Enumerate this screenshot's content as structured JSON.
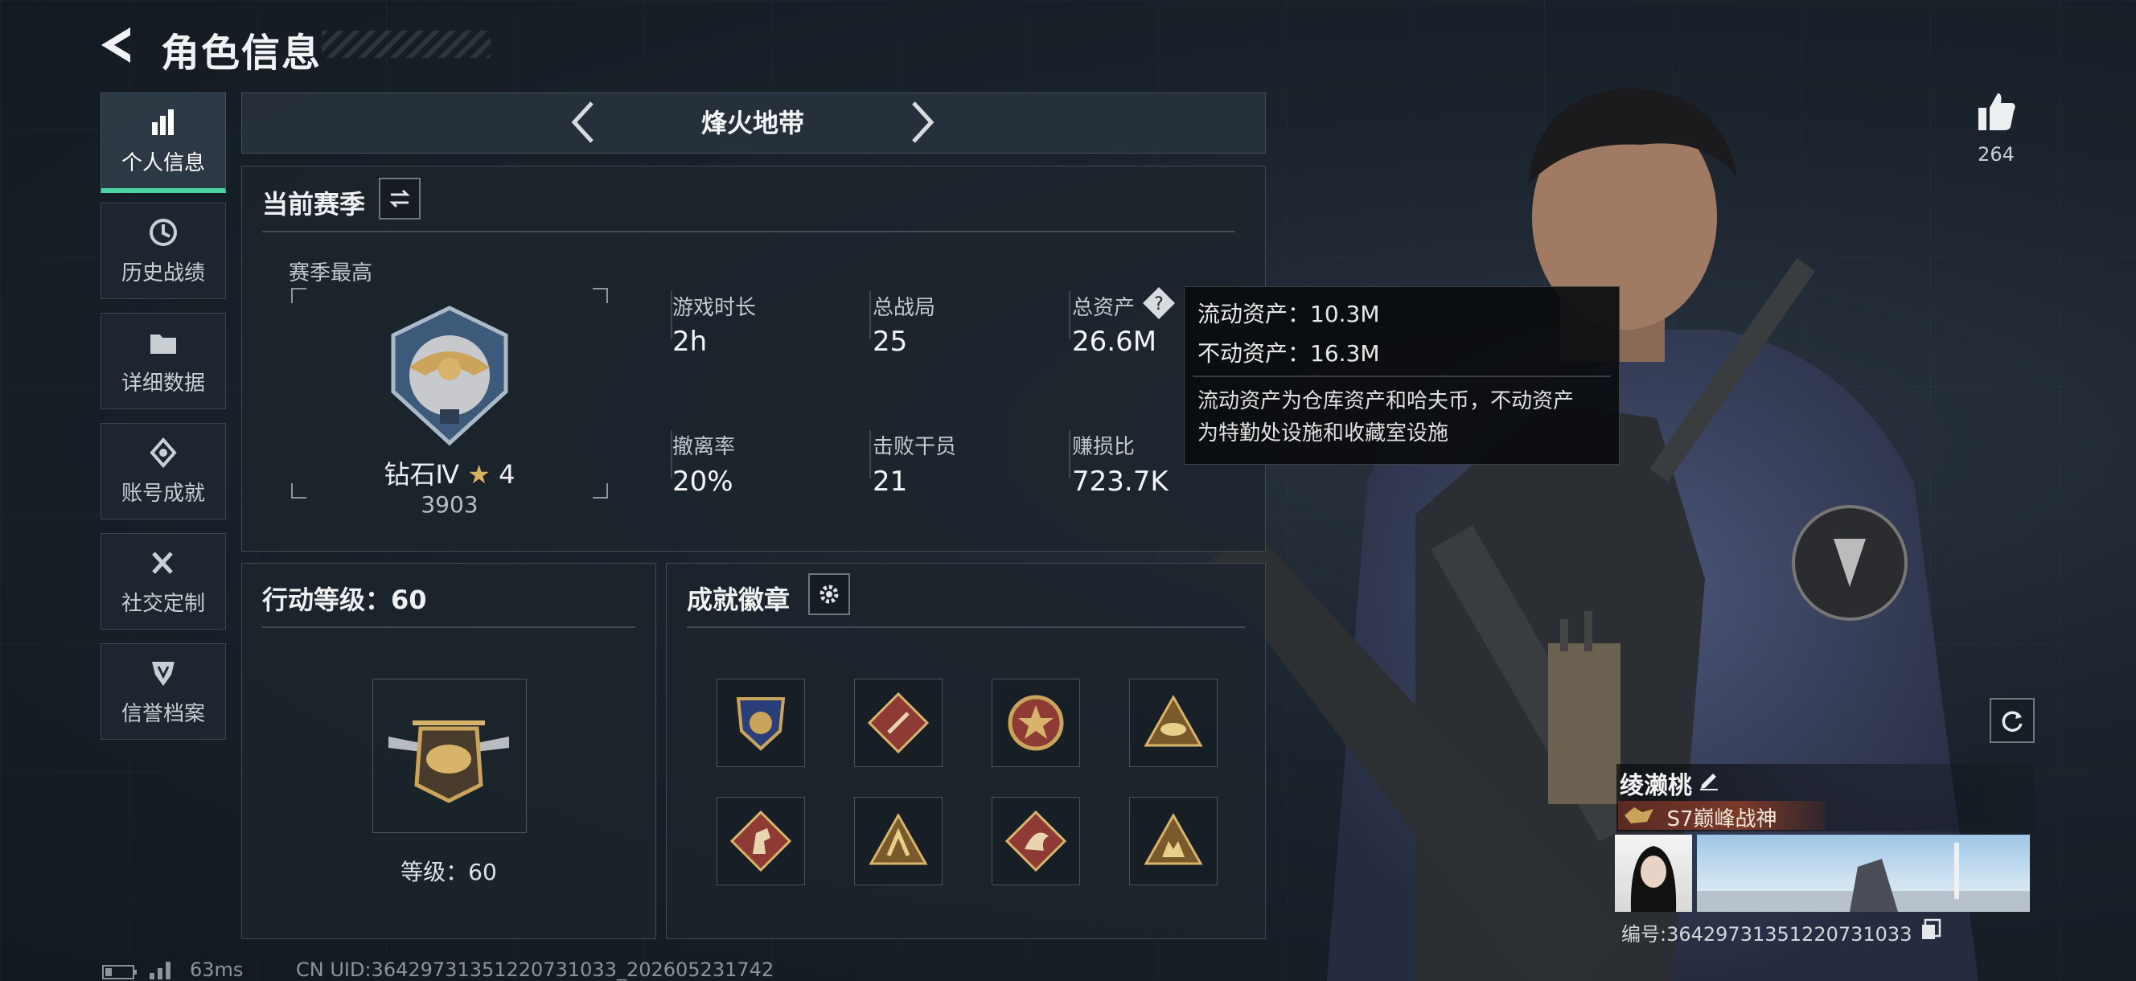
{
  "header": {
    "title": "角色信息"
  },
  "sidebar": {
    "items": [
      {
        "label": "个人信息",
        "icon": "bar-chart-icon",
        "active": true
      },
      {
        "label": "历史战绩",
        "icon": "history-clock-icon"
      },
      {
        "label": "详细数据",
        "icon": "folder-icon"
      },
      {
        "label": "账号成就",
        "icon": "achievement-icon"
      },
      {
        "label": "社交定制",
        "icon": "tools-icon"
      },
      {
        "label": "信誉档案",
        "icon": "credit-shield-icon"
      }
    ]
  },
  "mode": {
    "title": "烽火地带"
  },
  "season": {
    "title": "当前赛季",
    "best_label": "赛季最高",
    "rank_name": "钻石Ⅳ",
    "rank_stars": "4",
    "rank_score": "3903",
    "stats": [
      {
        "label": "游戏时长",
        "value": "2h"
      },
      {
        "label": "总战局",
        "value": "25"
      },
      {
        "label": "总资产",
        "value": "26.6M"
      },
      {
        "label": "撤离率",
        "value": "20%"
      },
      {
        "label": "击败干员",
        "value": "21"
      },
      {
        "label": "赚损比",
        "value": "723.7K"
      }
    ]
  },
  "tooltip": {
    "liquid": "流动资产：10.3M",
    "fixed": "不动资产：16.3M",
    "desc_line1": "流动资产为仓库资产和哈夫币，不动资产",
    "desc_line2": "为特勤处设施和收藏室设施"
  },
  "action_level": {
    "title": "行动等级：60",
    "level_text": "等级：60"
  },
  "achievements": {
    "title": "成就徽章",
    "badges": [
      "badge-1",
      "badge-2",
      "badge-3",
      "badge-4",
      "badge-5",
      "badge-6",
      "badge-7",
      "badge-8"
    ]
  },
  "likes": {
    "count": "264"
  },
  "player": {
    "name": "绫濑桃",
    "title_badge": "S7巅峰战神",
    "id_text": "编号:3642973135122073​1033"
  },
  "status": {
    "ping": "63ms",
    "uid": "CN UID:364297313512207​31033_202605231742"
  },
  "colors": {
    "accent_green": "#49d3a0",
    "tooltip_bg": "#0a0c0e",
    "badge_gold": "#c9a45a",
    "badge_red": "#8e3b36"
  }
}
